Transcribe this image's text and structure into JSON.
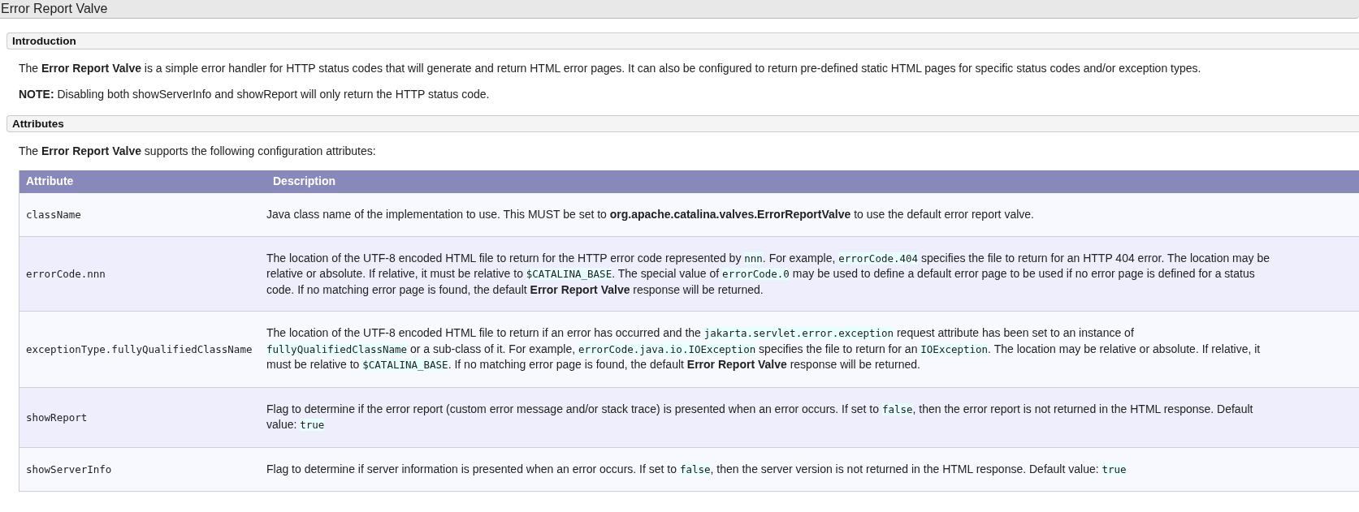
{
  "page_title": "Error Report Valve",
  "sections": [
    {
      "heading": "Introduction",
      "paragraphs": [
        "The **Error Report Valve** is a simple error handler for HTTP status codes that will generate and return HTML error pages. It can also be configured to return pre-defined static HTML pages for specific status codes and/or exception types.",
        "**NOTE:** Disabling both showServerInfo and showReport will only return the HTTP status code."
      ]
    },
    {
      "heading": "Attributes",
      "paragraphs": [
        "The **Error Report Valve** supports the following configuration attributes:"
      ]
    }
  ],
  "table": {
    "columns": [
      "Attribute",
      "Description"
    ],
    "rows": [
      {
        "attribute": "className",
        "description": [
          {
            "kind": "text",
            "text": "Java class name of the implementation to use. This MUST be set to "
          },
          {
            "kind": "bold",
            "text": "org.apache.catalina.valves.ErrorReportValve"
          },
          {
            "kind": "text",
            "text": " to use the default error report valve."
          }
        ]
      },
      {
        "attribute": "errorCode.nnn",
        "description": [
          {
            "kind": "text",
            "text": "The location of the UTF-8 encoded HTML file to return for the HTTP error code represented by "
          },
          {
            "kind": "code",
            "text": "nnn"
          },
          {
            "kind": "text",
            "text": ". For example, "
          },
          {
            "kind": "code",
            "text": "errorCode.404"
          },
          {
            "kind": "text",
            "text": " specifies the file to return for an HTTP 404 error. The location may be relative or absolute. If relative, it must be relative to "
          },
          {
            "kind": "code",
            "text": "$CATALINA_BASE"
          },
          {
            "kind": "text",
            "text": ". The special value of "
          },
          {
            "kind": "code",
            "text": "errorCode.0"
          },
          {
            "kind": "text",
            "text": " may be used to define a default error page to be used if no error page is defined for a status code. If no matching error page is found, the default "
          },
          {
            "kind": "bold",
            "text": "Error Report Valve"
          },
          {
            "kind": "text",
            "text": " response will be returned."
          }
        ]
      },
      {
        "attribute": "exceptionType.fullyQualifiedClassName",
        "description": [
          {
            "kind": "text",
            "text": "The location of the UTF-8 encoded HTML file to return if an error has occurred and the "
          },
          {
            "kind": "code",
            "text": "jakarta.servlet.error.exception"
          },
          {
            "kind": "text",
            "text": " request attribute has been set to an instance of "
          },
          {
            "kind": "code",
            "text": "fullyQualifiedClassName"
          },
          {
            "kind": "text",
            "text": " or a sub-class of it. For example, "
          },
          {
            "kind": "code",
            "text": "errorCode.java.io.IOException"
          },
          {
            "kind": "text",
            "text": " specifies the file to return for an "
          },
          {
            "kind": "code",
            "text": "IOException"
          },
          {
            "kind": "text",
            "text": ". The location may be relative or absolute. If relative, it must be relative to "
          },
          {
            "kind": "code",
            "text": "$CATALINA_BASE"
          },
          {
            "kind": "text",
            "text": ". If no matching error page is found, the default "
          },
          {
            "kind": "bold",
            "text": "Error Report Valve"
          },
          {
            "kind": "text",
            "text": " response will be returned."
          }
        ]
      },
      {
        "attribute": "showReport",
        "description": [
          {
            "kind": "text",
            "text": "Flag to determine if the error report (custom error message and/or stack trace) is presented when an error occurs. If set to "
          },
          {
            "kind": "code",
            "text": "false"
          },
          {
            "kind": "text",
            "text": ", then the error report is not returned in the HTML response. Default value: "
          },
          {
            "kind": "code",
            "text": "true"
          }
        ]
      },
      {
        "attribute": "showServerInfo",
        "description": [
          {
            "kind": "text",
            "text": "Flag to determine if server information is presented when an error occurs. If set to "
          },
          {
            "kind": "code",
            "text": "false"
          },
          {
            "kind": "text",
            "text": ", then the server version is not returned in the HTML response. Default value: "
          },
          {
            "kind": "code",
            "text": "true"
          }
        ]
      }
    ]
  }
}
